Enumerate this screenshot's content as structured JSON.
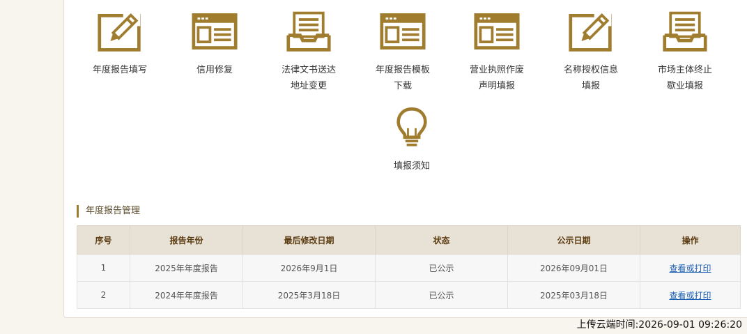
{
  "colors": {
    "accent": "#a07c2f",
    "header_bg": "#e8e1d6",
    "link": "#1a5fb4"
  },
  "services": [
    {
      "label": "年度报告填写",
      "icon": "pencil-icon"
    },
    {
      "label": "信用修复",
      "icon": "window-form-icon"
    },
    {
      "label": "法律文书送达\n地址变更",
      "icon": "inbox-tray-icon"
    },
    {
      "label": "年度报告模板\n下载",
      "icon": "window-form-icon"
    },
    {
      "label": "营业执照作废\n声明填报",
      "icon": "window-form-icon"
    },
    {
      "label": "名称授权信息\n填报",
      "icon": "pencil-icon"
    },
    {
      "label": "市场主体终止\n歇业填报",
      "icon": "inbox-tray-icon"
    },
    {
      "label": "填报须知",
      "icon": "lightbulb-icon"
    }
  ],
  "section": {
    "title": "年度报告管理"
  },
  "table": {
    "headers": [
      "序号",
      "报告年份",
      "最后修改日期",
      "状态",
      "公示日期",
      "操作"
    ],
    "rows": [
      [
        "1",
        "2025年年度报告",
        "2026年9月1日",
        "已公示",
        "2026年09月01日",
        "查看或打印"
      ],
      [
        "2",
        "2024年年度报告",
        "2025年3月18日",
        "已公示",
        "2025年03月18日",
        "查看或打印"
      ]
    ]
  },
  "footer": {
    "upload_time": "上传云端时间:2026-09-01 09:26:20"
  }
}
